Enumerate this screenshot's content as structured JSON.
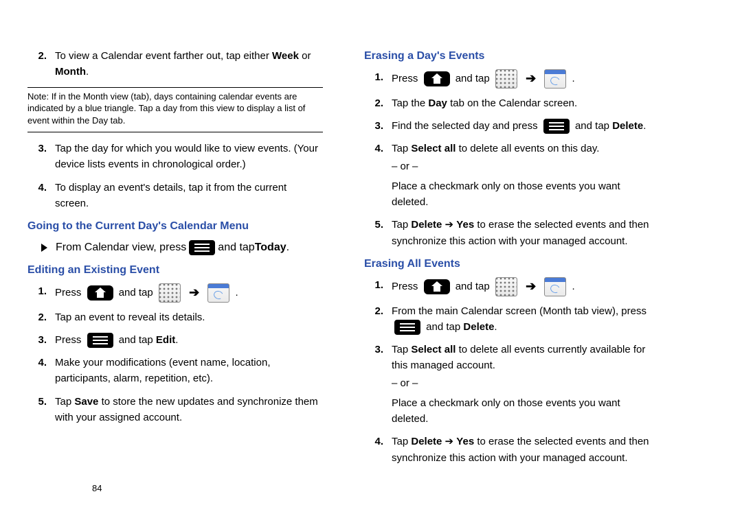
{
  "pagenum": "84",
  "left": {
    "step2_intro": "To view a Calendar event farther out, tap either ",
    "step2_bold1": "Week",
    "step2_or": " or ",
    "step2_bold2": "Month",
    "step2_period": ".",
    "note_label": "Note:",
    "note_body": " If in the Month view (tab), days containing calendar events are indicated by a blue triangle. Tap a day from this view to display a list of event within the Day tab.",
    "step3": "Tap the day for which you would like to view events. (Your device lists events in chronological order.)",
    "step4": "To display an event's details, tap it from the current screen.",
    "h_going": "Going to the Current Day's Calendar Menu",
    "going_pre": "From Calendar view, press ",
    "going_post": " and tap ",
    "going_today": "Today",
    "going_period": ".",
    "h_editing": "Editing an Existing Event",
    "e1_press": "Press ",
    "e1_andtap": " and tap ",
    "e2": "Tap an event to reveal its details.",
    "e3_press": "Press ",
    "e3_andtap": " and tap ",
    "e3_edit": "Edit",
    "e3_period": ".",
    "e4": "Make your modifications (event name, location, participants, alarm, repetition, etc).",
    "e5_pre": "Tap ",
    "e5_save": "Save",
    "e5_post": " to store the new updates and synchronize them with your assigned account."
  },
  "right": {
    "h_erase_day": "Erasing a Day's Events",
    "d1_press": "Press ",
    "d1_andtap": " and tap ",
    "d2_pre": "Tap the ",
    "d2_day": "Day",
    "d2_post": " tab on the Calendar screen.",
    "d3_pre": "Find the selected day and press ",
    "d3_post": " and tap ",
    "d3_del": "Delete",
    "d3_period": ".",
    "d4_pre": "Tap ",
    "d4_sel": "Select all",
    "d4_post": " to delete all events on this day.",
    "or": "– or –",
    "d4_alt": "Place a checkmark only on those events you want deleted.",
    "d5_pre": "Tap ",
    "d5_del": "Delete",
    "d5_arrow": " ➔ ",
    "d5_yes": "Yes",
    "d5_post": " to erase the selected events and then synchronize this action with your managed account.",
    "h_erase_all": "Erasing All Events",
    "a1_press": "Press ",
    "a1_andtap": " and tap ",
    "a2_pre": "From the main Calendar screen (Month tab view), press ",
    "a2_post": " and tap ",
    "a2_del": "Delete",
    "a2_period": ".",
    "a3_pre": "Tap ",
    "a3_sel": "Select all",
    "a3_post": " to delete all events currently available for this managed account.",
    "a3_alt": "Place a checkmark only on those events you want deleted.",
    "a4_pre": "Tap ",
    "a4_del": "Delete",
    "a4_arrow": " ➔ ",
    "a4_yes": "Yes",
    "a4_post": " to erase the selected events and then synchronize this action with your managed account."
  },
  "nums": {
    "n1": "1.",
    "n2": "2.",
    "n3": "3.",
    "n4": "4.",
    "n5": "5."
  }
}
